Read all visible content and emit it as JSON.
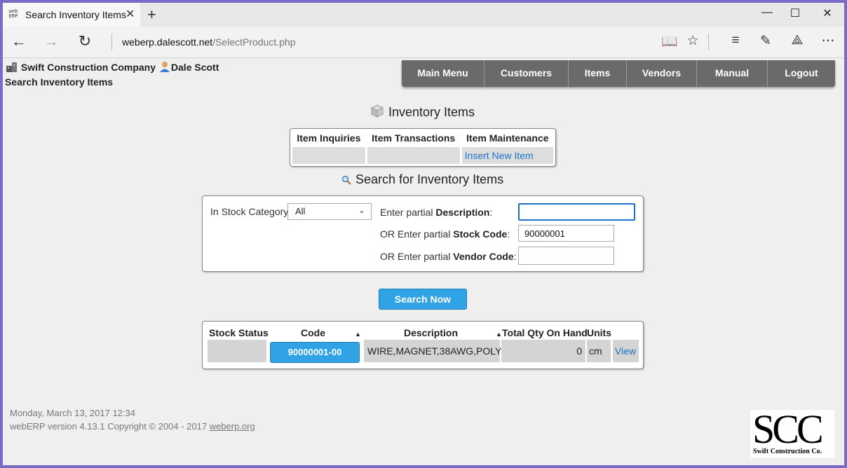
{
  "browser": {
    "tab_title": "Search Inventory Items",
    "tab_icon_text": "web ERP",
    "url_domain": "weberp.dalescott.net",
    "url_path": "/SelectProduct.php"
  },
  "header": {
    "company": "Swift Construction Company",
    "user": "Dale Scott",
    "page_title": "Search Inventory Items"
  },
  "menu": [
    "Main Menu",
    "Customers",
    "Items",
    "Vendors",
    "Manual",
    "Logout"
  ],
  "inventory": {
    "title": "Inventory Items",
    "headers": [
      "Item Inquiries",
      "Item Transactions",
      "Item Maintenance"
    ],
    "insert_link": "Insert New Item"
  },
  "search": {
    "title": "Search for Inventory Items",
    "category_label": "In Stock Category:",
    "category_value": "All",
    "desc_prefix": "Enter partial ",
    "desc_bold": "Description",
    "desc_suffix": ":",
    "desc_value": "",
    "code_prefix": "OR Enter partial ",
    "code_bold": "Stock Code",
    "code_suffix": ":",
    "code_value": "90000001",
    "vendor_prefix": "OR Enter partial ",
    "vendor_bold": "Vendor Code",
    "vendor_suffix": ":",
    "vendor_value": "",
    "button": "Search Now"
  },
  "results": {
    "headers": {
      "status": "Stock Status",
      "code": "Code",
      "description": "Description",
      "qty": "Total Qty On Hand",
      "units": "Units"
    },
    "row": {
      "status": "",
      "code": "90000001-00",
      "description": "WIRE,MAGNET,38AWG,POLY",
      "qty": "0",
      "units": "cm",
      "view": "View"
    }
  },
  "footer": {
    "date": "Monday, March 13, 2017 12:34",
    "version": "webERP version 4.13.1 Copyright © 2004 - 2017 ",
    "link": "weberp.org"
  },
  "logo": {
    "big": "SCC",
    "small": "Swift Construction Co."
  }
}
